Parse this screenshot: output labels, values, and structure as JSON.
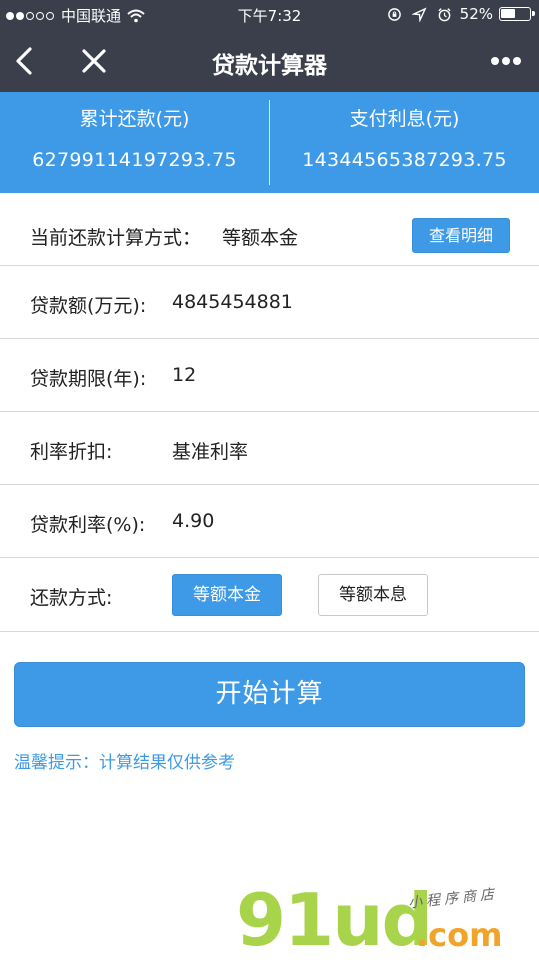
{
  "statusbar": {
    "carrier": "中国联通",
    "time": "下午7:32",
    "battery": "52%",
    "battery_level": 0.52,
    "signal_bars": 2
  },
  "navbar": {
    "title": "贷款计算器"
  },
  "summary": {
    "total_label": "累计还款(元)",
    "total_value": "62799114197293.75",
    "interest_label": "支付利息(元)",
    "interest_value": "14344565387293.75"
  },
  "mode": {
    "label": "当前还款计算方式：",
    "value": "等额本金",
    "detail_button": "查看明细"
  },
  "fields": {
    "amount_label": "贷款额(万元):",
    "amount_value": "4845454881",
    "term_label": "贷款期限(年):",
    "term_value": "12",
    "discount_label": "利率折扣:",
    "discount_value": "基准利率",
    "rate_label": "贷款利率(%):",
    "rate_value": "4.90"
  },
  "method": {
    "label": "还款方式:",
    "option_principal": "等额本金",
    "option_interest": "等额本息",
    "selected": "等额本金"
  },
  "calc_button": "开始计算",
  "tip": "温馨提示：计算结果仅供参考",
  "watermark": {
    "brand": "91ud",
    "domain": ".com",
    "tagline": "小程序商店"
  },
  "colors": {
    "header": "#3a3f4b",
    "accent": "#3e9ae7",
    "watermark_green": "#a7d44a",
    "watermark_orange": "#f0a42a"
  }
}
